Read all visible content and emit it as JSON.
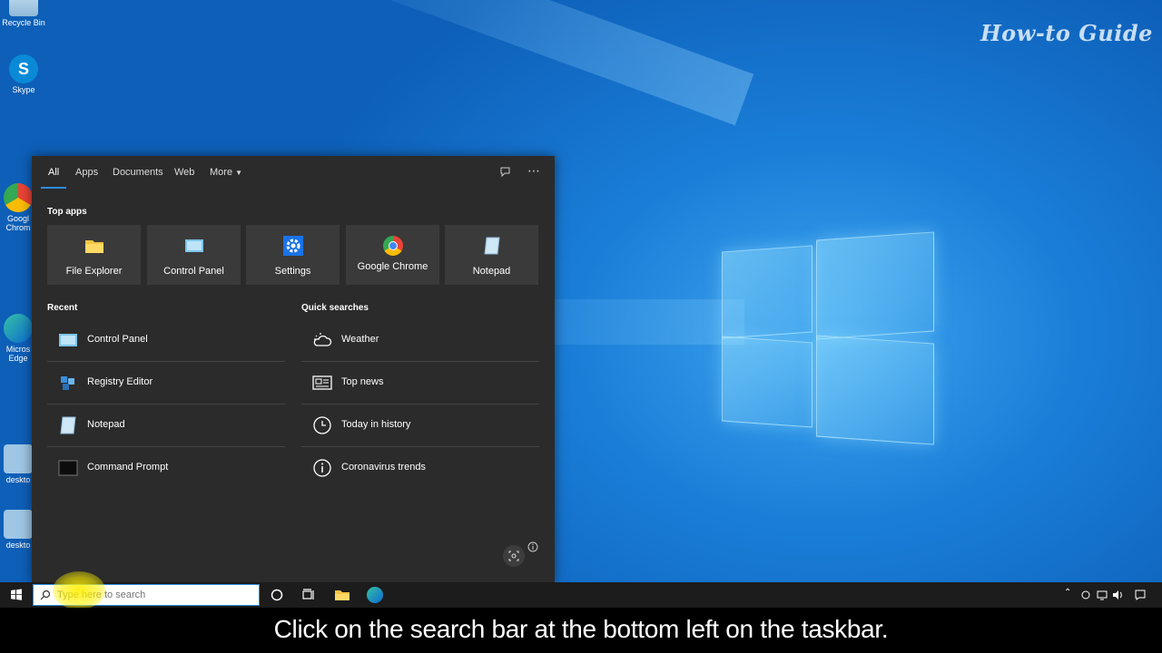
{
  "watermark": "How-to Guide",
  "desktop_icons": [
    {
      "label": "Recycle Bin",
      "icon": "recycle-bin-icon"
    },
    {
      "label": "Skype",
      "icon": "skype-icon"
    },
    {
      "label": "Googl Chrom",
      "icon": "chrome-icon"
    },
    {
      "label": "Micros Edge",
      "icon": "edge-icon"
    },
    {
      "label": "deskto",
      "icon": "gear-file-icon"
    },
    {
      "label": "deskto",
      "icon": "gear-file-icon"
    }
  ],
  "search_panel": {
    "tabs": [
      {
        "label": "All",
        "active": true
      },
      {
        "label": "Apps"
      },
      {
        "label": "Documents"
      },
      {
        "label": "Web"
      },
      {
        "label": "More"
      }
    ],
    "top_apps_title": "Top apps",
    "top_apps": [
      {
        "label": "File Explorer",
        "icon": "folder-icon"
      },
      {
        "label": "Control Panel",
        "icon": "control-panel-icon"
      },
      {
        "label": "Settings",
        "icon": "gear-icon"
      },
      {
        "label": "Google Chrome",
        "icon": "chrome-icon"
      },
      {
        "label": "Notepad",
        "icon": "notepad-icon"
      }
    ],
    "recent_title": "Recent",
    "recent": [
      {
        "label": "Control Panel",
        "icon": "control-panel-icon"
      },
      {
        "label": "Registry Editor",
        "icon": "registry-icon"
      },
      {
        "label": "Notepad",
        "icon": "notepad-icon"
      },
      {
        "label": "Command Prompt",
        "icon": "cmd-icon"
      }
    ],
    "quick_title": "Quick searches",
    "quick": [
      {
        "label": "Weather",
        "icon": "weather-icon"
      },
      {
        "label": "Top news",
        "icon": "news-icon"
      },
      {
        "label": "Today in history",
        "icon": "clock-icon"
      },
      {
        "label": "Coronavirus trends",
        "icon": "info-icon"
      }
    ]
  },
  "taskbar": {
    "search_placeholder": "Type here to search"
  },
  "caption": "Click on the search bar at the bottom left on the taskbar.",
  "colors": {
    "accent": "#2d8ce0",
    "panel_bg": "#2b2b2b",
    "tile_bg": "#3a3a3a",
    "taskbar_bg": "#1c1c1c"
  }
}
